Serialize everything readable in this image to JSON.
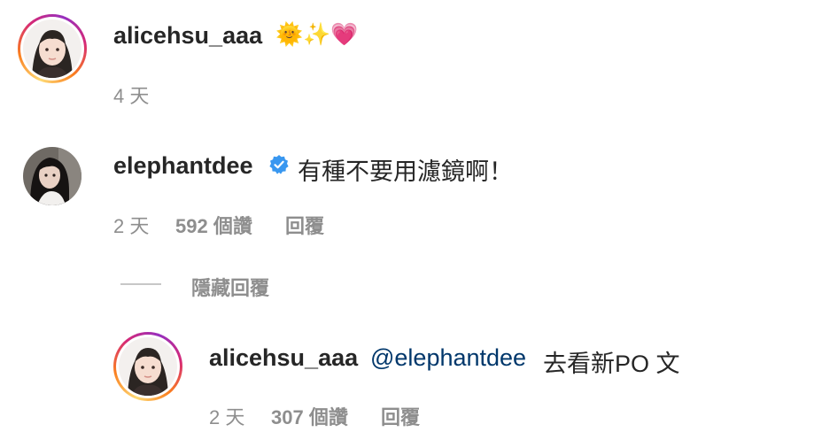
{
  "comments": [
    {
      "username": "alicehsu_aaa",
      "emoji": "🌞✨💗",
      "time": "4 天"
    },
    {
      "username": "elephantdee",
      "verified": true,
      "text": "有種不要用濾鏡啊！",
      "time": "2 天",
      "likes": "592 個讚",
      "reply_label": "回覆",
      "hide_replies_label": "隱藏回覆"
    }
  ],
  "reply": {
    "username": "alicehsu_aaa",
    "mention": "@elephantdee",
    "text": "去看新PO 文",
    "time": "2 天",
    "likes": "307 個讚",
    "reply_label": "回覆"
  },
  "colors": {
    "verified_badge": "#3897f0",
    "mention": "#00376b",
    "meta": "#8e8e8e"
  }
}
